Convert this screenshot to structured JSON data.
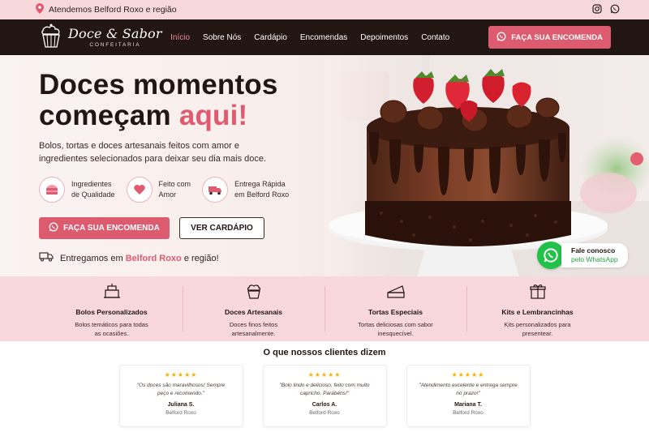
{
  "topbar": {
    "location_text": "Atendemos Belford Roxo e região"
  },
  "brand": {
    "name": "Doce & Sabor",
    "tagline": "CONFEITARIA"
  },
  "nav": {
    "items": [
      "Início",
      "Sobre Nós",
      "Cardápio",
      "Encomendas",
      "Depoimentos",
      "Contato"
    ],
    "cta": "FAÇA SUA ENCOMENDA"
  },
  "hero": {
    "title_line1": "Doces momentos",
    "title_line2_prefix": "começam ",
    "title_accent": "aqui!",
    "lead": "Bolos, tortas e doces artesanais feitos com amor e ingredientes selecionados para deixar seu dia mais doce.",
    "features": [
      {
        "line1": "Ingredientes",
        "line2": "de Qualidade",
        "icon": "cake-slice-icon"
      },
      {
        "line1": "Feito com",
        "line2": "Amor",
        "icon": "heart-icon"
      },
      {
        "line1": "Entrega Rápida",
        "line2": "em Belford Roxo",
        "icon": "truck-icon"
      }
    ],
    "primary_button": "FAÇA SUA ENCOMENDA",
    "secondary_button": "VER CARDÁPIO",
    "delivery_prefix": "Entregamos em ",
    "delivery_city": "Belford Roxo",
    "delivery_suffix": " e região!"
  },
  "whatsapp": {
    "line1": "Fale conosco",
    "line2": "pelo WhatsApp"
  },
  "categories": [
    {
      "title": "Bolos Personalizados",
      "desc": "Bolos temáticos para todas as ocasiões.",
      "icon": "cake-icon"
    },
    {
      "title": "Doces Artesanais",
      "desc": "Doces finos feitos artesanalmente.",
      "icon": "cupcake-icon"
    },
    {
      "title": "Tortas Especiais",
      "desc": "Tortas deliciosas com sabor inesquecível.",
      "icon": "pie-slice-icon"
    },
    {
      "title": "Kits e Lembrancinhas",
      "desc": "Kits personalizados para presentear.",
      "icon": "gift-icon"
    }
  ],
  "testimonials": {
    "heading": "O que nossos clientes dizem",
    "items": [
      {
        "stars": "★★★★★",
        "quote": "\"Os doces são maravilhosos! Sempre peço e recomendo.\"",
        "name": "Juliana S.",
        "city": "Belford Roxo"
      },
      {
        "stars": "★★★★★",
        "quote": "\"Bolo lindo e delicioso, feito com muito capricho. Parabéns!\"",
        "name": "Carlos A.",
        "city": "Belford Roxo"
      },
      {
        "stars": "★★★★★",
        "quote": "\"Atendimento excelente e entrega sempre no prazo!\"",
        "name": "Mariana T.",
        "city": "Belford Roxo"
      }
    ]
  },
  "colors": {
    "accent": "#dd5b6f",
    "dark": "#221612",
    "pink_bg": "#f8d8dc",
    "whatsapp": "#22c14a"
  }
}
